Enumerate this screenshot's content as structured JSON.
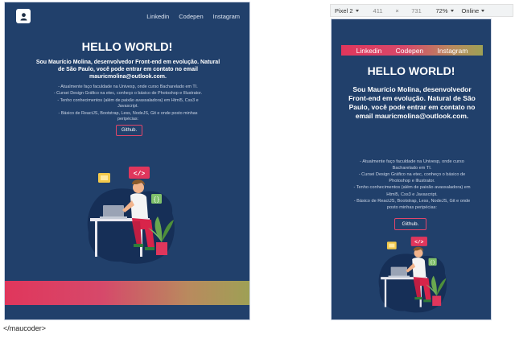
{
  "desktop": {
    "nav": [
      "Linkedin",
      "Codepen",
      "Instagram"
    ],
    "title": "HELLO WORLD!",
    "intro": "Sou Maurício Molina, desenvolvedor Front-end em evolução. Natural de São Paulo, você pode entrar em contato no email mauricmolina@outlook.com.",
    "list": [
      "- Atualmente faço faculdade na Univesp, onde curso Bacharelado em TI.",
      "- Cursei Design Gráfico na etec, conheço o básico de Photoshop e Illustrator.",
      "- Tenho conhecimentos (além de paixão avassaladora) em Html5, Css3 e Javascript.",
      "- Básico de ReactJS, Bootstrap, Less, NodeJS, Git e onde posto minhas peripécias:"
    ],
    "button": "Github."
  },
  "devtools": {
    "device": "Pixel 2",
    "width": "411",
    "times": "×",
    "height": "731",
    "zoom": "72%",
    "network": "Online"
  },
  "mobile": {
    "nav": [
      "Linkedin",
      "Codepen",
      "Instagram"
    ],
    "title": "HELLO WORLD!",
    "intro": "Sou Maurício Molina, desenvolvedor Front-end em evolução. Natural de São Paulo, você pode entrar em contato no email mauricmolina@outlook.com.",
    "list": [
      "- Atualmente faço faculdade na Univesp, onde curso Bacharelado em TI.",
      "- Cursei Design Gráfico na etec, conheço o básico de Photoshop e Illustrator.",
      "- Tenho conhecimentos (além de paixão avassaladora) em Html5, Css3 e Javascript.",
      "- Básico de ReactJS, Bootstrap, Less, NodeJS, Git e onde posto minhas peripécias:"
    ],
    "button": "Github."
  },
  "illustration": {
    "code_tag": "</>",
    "brackets": "{}"
  },
  "caption": "</maucoder>",
  "colors": {
    "page_bg": "#21406b",
    "blob": "#162f57",
    "accent_pink": "#e0365c",
    "accent_olive": "#9ea055"
  },
  "icons": [
    "user-logo-icon",
    "code-tag-icon",
    "braces-icon",
    "plant-icon",
    "laptop-icon",
    "dropdown-caret-icon"
  ]
}
